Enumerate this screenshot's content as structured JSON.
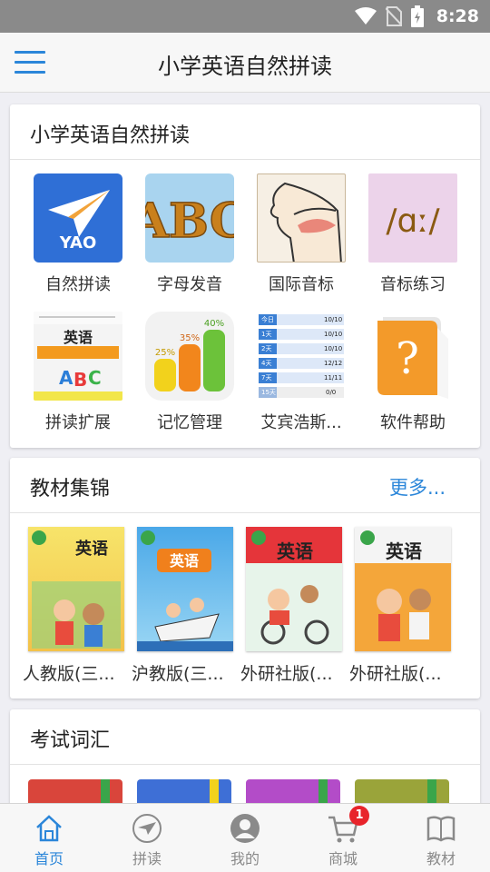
{
  "status_bar": {
    "time": "8:28"
  },
  "app_bar": {
    "title": "小学英语自然拼读"
  },
  "phonics_section": {
    "title": "小学英语自然拼读",
    "items": [
      {
        "label": "自然拼读",
        "icon": "paper-plane-icon",
        "icon_text": "YAO"
      },
      {
        "label": "字母发音",
        "icon": "abc-letters-icon",
        "icon_text": "ABC"
      },
      {
        "label": "国际音标",
        "icon": "mouth-diagram-icon"
      },
      {
        "label": "音标练习",
        "icon": "phonetic-symbol-icon",
        "icon_text": "/ɑː/"
      },
      {
        "label": "拼读扩展",
        "icon": "phonics-book-icon",
        "icon_text": "英语"
      },
      {
        "label": "记忆管理",
        "icon": "memory-chart-icon",
        "chart_values": [
          "25%",
          "35%",
          "40%"
        ]
      },
      {
        "label": "艾宾浩斯...",
        "icon": "ebbinghaus-table-icon",
        "table_rows": [
          [
            "今日",
            "10/10"
          ],
          [
            "1天",
            "10/10"
          ],
          [
            "2天",
            "10/10"
          ],
          [
            "4天",
            "12/12"
          ],
          [
            "7天",
            "11/11"
          ],
          [
            "15天",
            "0/0"
          ]
        ]
      },
      {
        "label": "软件帮助",
        "icon": "help-book-icon",
        "icon_text": "?"
      }
    ]
  },
  "textbook_section": {
    "title": "教材集锦",
    "more_label": "更多...",
    "books": [
      {
        "label": "人教版(三...",
        "cover_title": "英语"
      },
      {
        "label": "沪教版(三...",
        "cover_title": "英语"
      },
      {
        "label": "外研社版(...",
        "cover_title": "英语"
      },
      {
        "label": "外研社版(...",
        "cover_title": "英语"
      }
    ]
  },
  "vocab_section": {
    "title": "考试词汇"
  },
  "tab_bar": {
    "tabs": [
      {
        "label": "首页",
        "icon": "home-icon",
        "active": true
      },
      {
        "label": "拼读",
        "icon": "paper-plane-circle-icon",
        "active": false
      },
      {
        "label": "我的",
        "icon": "user-icon",
        "active": false
      },
      {
        "label": "商城",
        "icon": "cart-icon",
        "active": false,
        "badge": "1"
      },
      {
        "label": "教材",
        "icon": "book-icon",
        "active": false
      }
    ]
  },
  "colors": {
    "accent": "#2b86d9",
    "badge": "#e8242b",
    "status_bar": "#8a8a8a"
  }
}
